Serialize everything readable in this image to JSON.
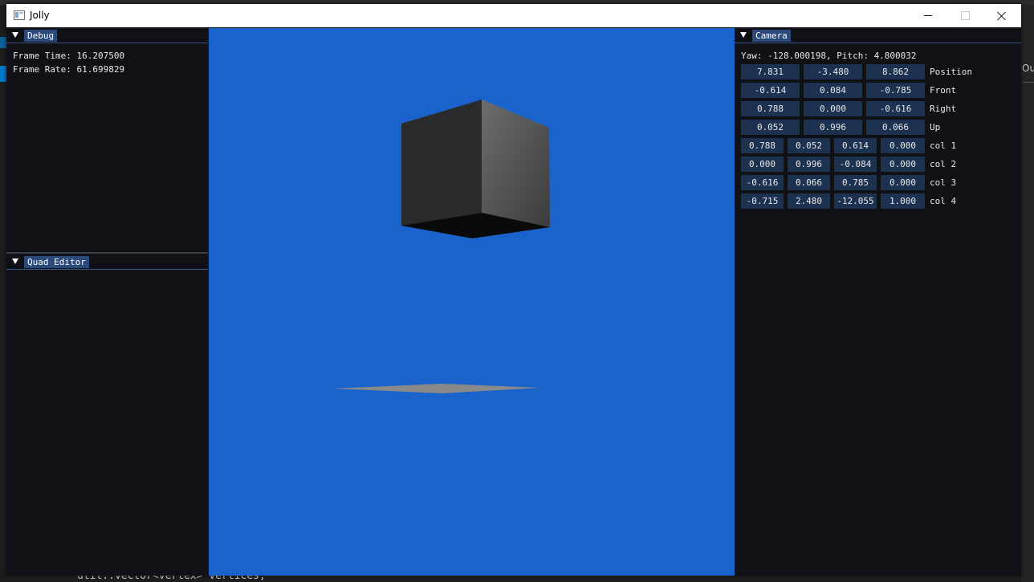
{
  "window": {
    "title": "Jolly"
  },
  "background": {
    "right_text": "Ou",
    "code_text": "util::vector<vertex> vertices;"
  },
  "debug": {
    "tab": "Debug",
    "lines": [
      "Frame Time: 16.207500",
      "Frame Rate: 61.699829"
    ]
  },
  "quad_editor": {
    "tab": "Quad Editor"
  },
  "camera": {
    "tab": "Camera",
    "yaw_pitch": "Yaw: -128.000198, Pitch: 4.800032",
    "vectors": [
      {
        "label": "Position",
        "values": [
          "7.831",
          "-3.480",
          "8.862"
        ]
      },
      {
        "label": "Front",
        "values": [
          "-0.614",
          "0.084",
          "-0.785"
        ]
      },
      {
        "label": "Right",
        "values": [
          "0.788",
          "0.000",
          "-0.616"
        ]
      },
      {
        "label": "Up",
        "values": [
          "0.052",
          "0.996",
          "0.066"
        ]
      }
    ],
    "matrix": [
      {
        "label": "col 1",
        "values": [
          "0.788",
          "0.052",
          "0.614",
          "0.000"
        ]
      },
      {
        "label": "col 2",
        "values": [
          "0.000",
          "0.996",
          "-0.084",
          "0.000"
        ]
      },
      {
        "label": "col 3",
        "values": [
          "-0.616",
          "0.066",
          "0.785",
          "0.000"
        ]
      },
      {
        "label": "col 4",
        "values": [
          "-0.715",
          "2.480",
          "-12.055",
          "1.000"
        ]
      }
    ]
  },
  "colors": {
    "viewport_bg": "#1a63cc",
    "field_bg": "#1c3250",
    "tab_bg": "#294a7a",
    "panel_bg": "#0f1116"
  }
}
